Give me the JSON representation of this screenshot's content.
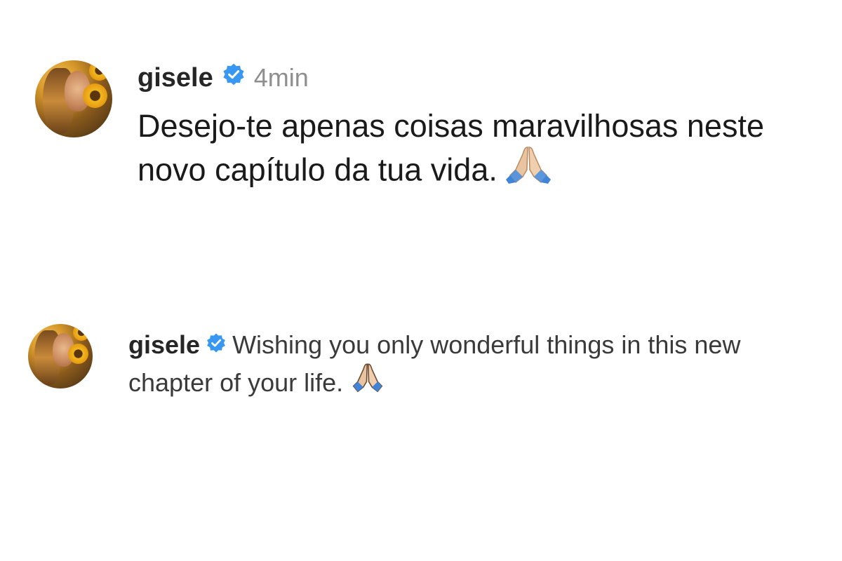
{
  "post_original": {
    "username": "gisele",
    "verified": true,
    "time": "4min",
    "comment": "Desejo-te apenas coisas maravilhosas neste novo capítulo da tua vida.",
    "emoji_icon": "folded-hands-icon"
  },
  "post_translated": {
    "username": "gisele",
    "verified": true,
    "comment": "Wishing you only wonderful things in this new chapter of your life.",
    "emoji_icon": "folded-hands-icon"
  },
  "colors": {
    "verified_badge": "#3897f0",
    "text": "#1a1a1a",
    "muted": "#8e8e8e"
  }
}
